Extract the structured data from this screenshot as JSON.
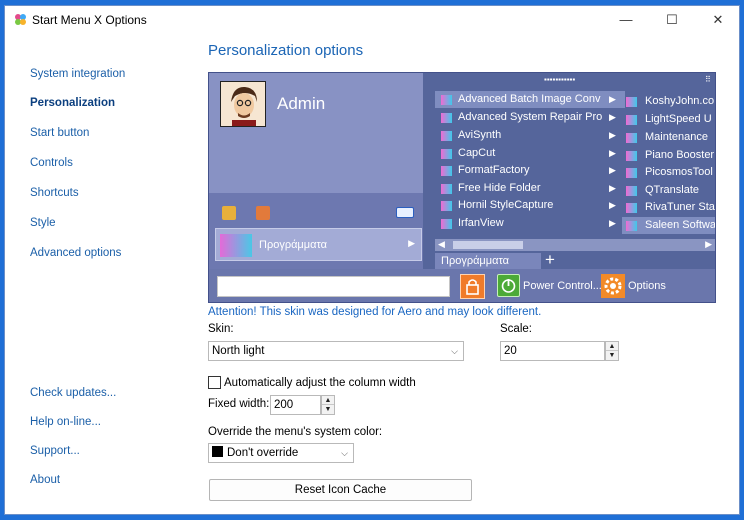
{
  "window": {
    "title": "Start Menu X Options",
    "minimize_icon": "—",
    "maximize_icon": "☐",
    "close_icon": "✕"
  },
  "sidebar": {
    "items": [
      {
        "label": "System integration",
        "active": false
      },
      {
        "label": "Personalization",
        "active": true
      },
      {
        "label": "Start button",
        "active": false
      },
      {
        "label": "Controls",
        "active": false
      },
      {
        "label": "Shortcuts",
        "active": false
      },
      {
        "label": "Style",
        "active": false
      },
      {
        "label": "Advanced options",
        "active": false
      }
    ],
    "bottom_items": [
      {
        "label": "Check updates..."
      },
      {
        "label": "Help on-line..."
      },
      {
        "label": "Support..."
      },
      {
        "label": "About"
      }
    ]
  },
  "main": {
    "heading": "Personalization options",
    "preview": {
      "user_name": "Admin",
      "programs_label": "Προγράμματα",
      "tab_label": "Προγράμματα",
      "grip": "▪▪▪▪▪▪▪▪▪▪▪",
      "menu_items": [
        "Advanced Batch Image Conv",
        "Advanced System Repair Pro",
        "AviSynth",
        "CapCut",
        "FormatFactory",
        "Free Hide Folder",
        "Hornil StyleCapture",
        "IrfanView"
      ],
      "menu_items_2": [
        "KoshyJohn.co",
        "LightSpeed U",
        "Maintenance",
        "Piano Booster",
        "PicosmosTool",
        "QTranslate",
        "RivaTuner Sta",
        "Saleen Softwa"
      ],
      "power_label": "Power Control...",
      "options_label": "Options"
    },
    "attention": "Attention! This skin was designed for Aero and may look different.",
    "skin_label": "Skin:",
    "skin_value": "North light",
    "scale_label": "Scale:",
    "scale_value": "20",
    "auto_adjust_label": "Automatically adjust the column width",
    "auto_adjust_checked": false,
    "fixed_width_label": "Fixed width:",
    "fixed_width_value": "200",
    "override_color_label": "Override the menu's system color:",
    "override_color_value": "Don't override",
    "override_color_swatch": "#000000",
    "reset_button": "Reset Icon Cache"
  },
  "colors": {
    "link": "#1b5fa8",
    "heading": "#1b65b5",
    "preview_bg": "#5a6aa0",
    "desktop_bg": "#1f6fd6"
  }
}
